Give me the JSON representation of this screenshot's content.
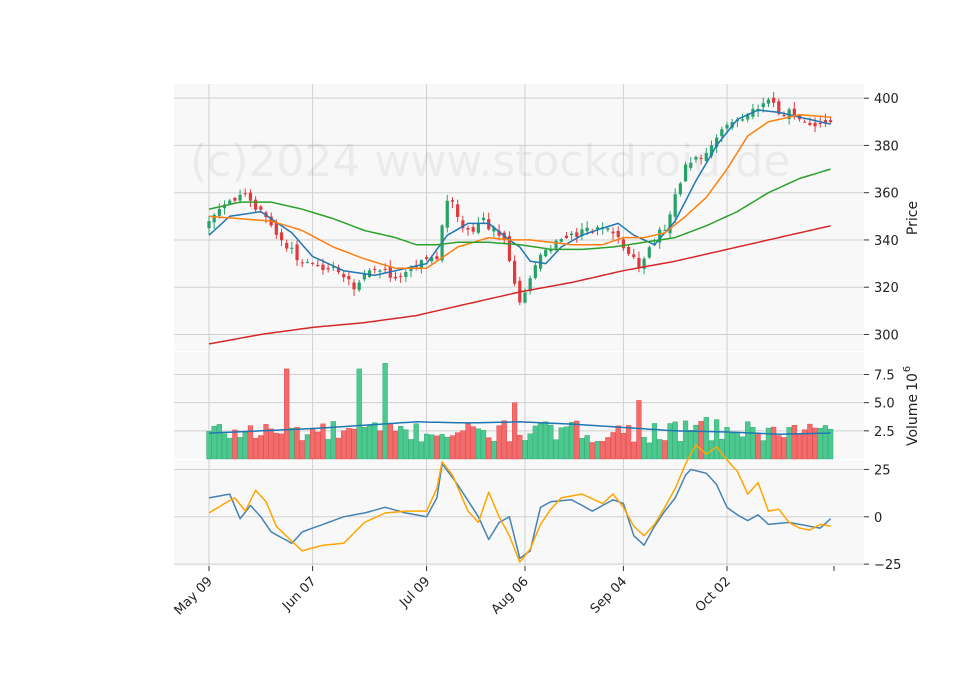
{
  "watermark": "(c)2024 www.stockdroid.de",
  "colors": {
    "up": "#26a269",
    "up_fill": "#4cc98f",
    "down": "#e0393e",
    "down_fill": "#f26c6c",
    "ma_fast": "#1f77b4",
    "ma_mid": "#ff7f0e",
    "ma_slow": "#2ca02c",
    "ma_long": "#d62728",
    "vol_ma": "#1f77b4",
    "osc_a": "#4682b4",
    "osc_b": "#ffa500",
    "grid": "#d0d0d0",
    "panel_bg": "#f8f8f8"
  },
  "chart_data": {
    "type": "candlestick",
    "x_tick_labels": [
      "May 09",
      "Jun 07",
      "Jul 09",
      "Aug 06",
      "Sep 04",
      "Oct 02"
    ],
    "x_tick_index": [
      0,
      20,
      42,
      61,
      80,
      100
    ],
    "n_sessions": 121,
    "panels": [
      {
        "name": "price",
        "ylabel": "Price",
        "ylim": [
          293,
          406
        ],
        "yticks": [
          300,
          320,
          340,
          360,
          380,
          400
        ],
        "price_anchors": [
          [
            0,
            348
          ],
          [
            6,
            360
          ],
          [
            12,
            347
          ],
          [
            18,
            329
          ],
          [
            24,
            328
          ],
          [
            28,
            321
          ],
          [
            32,
            329
          ],
          [
            36,
            325
          ],
          [
            40,
            329
          ],
          [
            44,
            333
          ],
          [
            46,
            358
          ],
          [
            50,
            343
          ],
          [
            53,
            348
          ],
          [
            57,
            340
          ],
          [
            60,
            314
          ],
          [
            64,
            334
          ],
          [
            67,
            338
          ],
          [
            72,
            344
          ],
          [
            77,
            346
          ],
          [
            80,
            338
          ],
          [
            83,
            330
          ],
          [
            88,
            346
          ],
          [
            92,
            370
          ],
          [
            96,
            378
          ],
          [
            100,
            388
          ],
          [
            104,
            392
          ],
          [
            108,
            399
          ],
          [
            110,
            394
          ],
          [
            114,
            393
          ],
          [
            118,
            388
          ],
          [
            120,
            388
          ]
        ],
        "series": [
          {
            "key": "ma_fast",
            "anchors": [
              [
                0,
                342
              ],
              [
                4,
                350
              ],
              [
                10,
                352
              ],
              [
                16,
                343
              ],
              [
                20,
                333
              ],
              [
                26,
                327
              ],
              [
                32,
                325
              ],
              [
                38,
                328
              ],
              [
                42,
                330
              ],
              [
                46,
                342
              ],
              [
                50,
                347
              ],
              [
                54,
                347
              ],
              [
                58,
                340
              ],
              [
                60,
                337
              ],
              [
                62,
                331
              ],
              [
                65,
                330
              ],
              [
                68,
                337
              ],
              [
                72,
                342
              ],
              [
                76,
                345
              ],
              [
                79,
                347
              ],
              [
                82,
                342
              ],
              [
                86,
                338
              ],
              [
                90,
                348
              ],
              [
                94,
                365
              ],
              [
                98,
                380
              ],
              [
                102,
                391
              ],
              [
                106,
                395
              ],
              [
                110,
                394
              ],
              [
                114,
                392
              ],
              [
                118,
                390
              ],
              [
                120,
                389
              ]
            ]
          },
          {
            "key": "ma_mid",
            "anchors": [
              [
                0,
                350
              ],
              [
                6,
                349
              ],
              [
                12,
                348
              ],
              [
                18,
                344
              ],
              [
                24,
                337
              ],
              [
                30,
                332
              ],
              [
                36,
                328
              ],
              [
                42,
                328
              ],
              [
                48,
                337
              ],
              [
                54,
                341
              ],
              [
                58,
                340
              ],
              [
                62,
                340
              ],
              [
                66,
                339
              ],
              [
                70,
                338
              ],
              [
                76,
                338
              ],
              [
                80,
                341
              ],
              [
                84,
                341
              ],
              [
                88,
                343
              ],
              [
                92,
                350
              ],
              [
                96,
                358
              ],
              [
                100,
                370
              ],
              [
                104,
                384
              ],
              [
                108,
                390
              ],
              [
                114,
                393
              ],
              [
                120,
                392
              ]
            ]
          },
          {
            "key": "ma_slow",
            "anchors": [
              [
                0,
                353
              ],
              [
                6,
                356
              ],
              [
                12,
                356
              ],
              [
                18,
                353
              ],
              [
                24,
                349
              ],
              [
                30,
                344
              ],
              [
                36,
                341
              ],
              [
                40,
                338
              ],
              [
                44,
                338
              ],
              [
                48,
                339
              ],
              [
                54,
                339
              ],
              [
                60,
                338
              ],
              [
                66,
                336
              ],
              [
                72,
                336
              ],
              [
                78,
                337
              ],
              [
                84,
                339
              ],
              [
                90,
                341
              ],
              [
                96,
                346
              ],
              [
                102,
                352
              ],
              [
                108,
                360
              ],
              [
                114,
                366
              ],
              [
                120,
                370
              ]
            ]
          },
          {
            "key": "ma_long",
            "anchors": [
              [
                0,
                296
              ],
              [
                10,
                300
              ],
              [
                20,
                303
              ],
              [
                30,
                305
              ],
              [
                40,
                308
              ],
              [
                50,
                313
              ],
              [
                60,
                318
              ],
              [
                70,
                322
              ],
              [
                80,
                327
              ],
              [
                90,
                331
              ],
              [
                100,
                336
              ],
              [
                110,
                341
              ],
              [
                120,
                346
              ]
            ]
          }
        ]
      },
      {
        "name": "volume",
        "ylabel": "Volume",
        "unit_exponent": "6",
        "ylim": [
          0,
          9.5
        ],
        "yticks": [
          2.5,
          5.0,
          7.5
        ],
        "ytick_labels": [
          "2.5",
          "5.0",
          "7.5"
        ],
        "spikes": {
          "15": 8.0,
          "29": 8.0,
          "34": 8.5,
          "59": 5.0,
          "83": 5.2,
          "96": 3.7,
          "98": 3.5,
          "116": 3.1
        },
        "ma_anchors": [
          [
            0,
            2.3
          ],
          [
            10,
            2.5
          ],
          [
            20,
            2.7
          ],
          [
            30,
            3.0
          ],
          [
            40,
            3.3
          ],
          [
            50,
            3.2
          ],
          [
            60,
            3.3
          ],
          [
            70,
            3.1
          ],
          [
            80,
            2.8
          ],
          [
            90,
            2.5
          ],
          [
            100,
            2.4
          ],
          [
            110,
            2.2
          ],
          [
            120,
            2.3
          ]
        ]
      },
      {
        "name": "oscillator",
        "ylabel": "",
        "ylim": [
          -26,
          30
        ],
        "yticks": [
          -25,
          0,
          25
        ],
        "ytick_labels": [
          "−25",
          "0",
          "25"
        ],
        "series": [
          {
            "key": "osc_a",
            "anchors": [
              [
                0,
                10
              ],
              [
                4,
                12
              ],
              [
                6,
                -1
              ],
              [
                8,
                6
              ],
              [
                10,
                0
              ],
              [
                12,
                -8
              ],
              [
                16,
                -14
              ],
              [
                18,
                -8
              ],
              [
                22,
                -4
              ],
              [
                26,
                0
              ],
              [
                30,
                2
              ],
              [
                34,
                5
              ],
              [
                38,
                2
              ],
              [
                42,
                0
              ],
              [
                44,
                10
              ],
              [
                45,
                28
              ],
              [
                48,
                17
              ],
              [
                52,
                0
              ],
              [
                54,
                -12
              ],
              [
                56,
                -3
              ],
              [
                58,
                0
              ],
              [
                60,
                -22
              ],
              [
                62,
                -18
              ],
              [
                64,
                5
              ],
              [
                66,
                8
              ],
              [
                70,
                9
              ],
              [
                74,
                3
              ],
              [
                78,
                9
              ],
              [
                80,
                7
              ],
              [
                82,
                -10
              ],
              [
                84,
                -15
              ],
              [
                86,
                -5
              ],
              [
                88,
                3
              ],
              [
                90,
                10
              ],
              [
                92,
                22
              ],
              [
                93,
                25
              ],
              [
                96,
                23
              ],
              [
                98,
                17
              ],
              [
                100,
                5
              ],
              [
                102,
                1
              ],
              [
                104,
                -2
              ],
              [
                106,
                1
              ],
              [
                108,
                -4
              ],
              [
                112,
                -3
              ],
              [
                114,
                -4
              ],
              [
                118,
                -6
              ],
              [
                120,
                -1
              ]
            ]
          },
          {
            "key": "osc_b",
            "anchors": [
              [
                0,
                2
              ],
              [
                3,
                7
              ],
              [
                5,
                10
              ],
              [
                7,
                3
              ],
              [
                9,
                14
              ],
              [
                11,
                8
              ],
              [
                13,
                -5
              ],
              [
                16,
                -13
              ],
              [
                18,
                -18
              ],
              [
                22,
                -15
              ],
              [
                26,
                -14
              ],
              [
                30,
                -3
              ],
              [
                34,
                2
              ],
              [
                38,
                3
              ],
              [
                42,
                3
              ],
              [
                44,
                15
              ],
              [
                45,
                29
              ],
              [
                47,
                22
              ],
              [
                50,
                3
              ],
              [
                52,
                -3
              ],
              [
                54,
                13
              ],
              [
                56,
                0
              ],
              [
                58,
                -10
              ],
              [
                60,
                -24
              ],
              [
                62,
                -17
              ],
              [
                64,
                -4
              ],
              [
                66,
                4
              ],
              [
                68,
                10
              ],
              [
                72,
                12
              ],
              [
                76,
                7
              ],
              [
                78,
                12
              ],
              [
                80,
                5
              ],
              [
                82,
                -5
              ],
              [
                84,
                -10
              ],
              [
                86,
                -4
              ],
              [
                88,
                5
              ],
              [
                90,
                15
              ],
              [
                92,
                28
              ],
              [
                94,
                38
              ],
              [
                96,
                33
              ],
              [
                98,
                37
              ],
              [
                100,
                30
              ],
              [
                102,
                24
              ],
              [
                104,
                12
              ],
              [
                106,
                18
              ],
              [
                108,
                3
              ],
              [
                110,
                4
              ],
              [
                112,
                -3
              ],
              [
                114,
                -6
              ],
              [
                116,
                -7
              ],
              [
                118,
                -4
              ],
              [
                120,
                -5
              ]
            ]
          }
        ]
      }
    ]
  }
}
